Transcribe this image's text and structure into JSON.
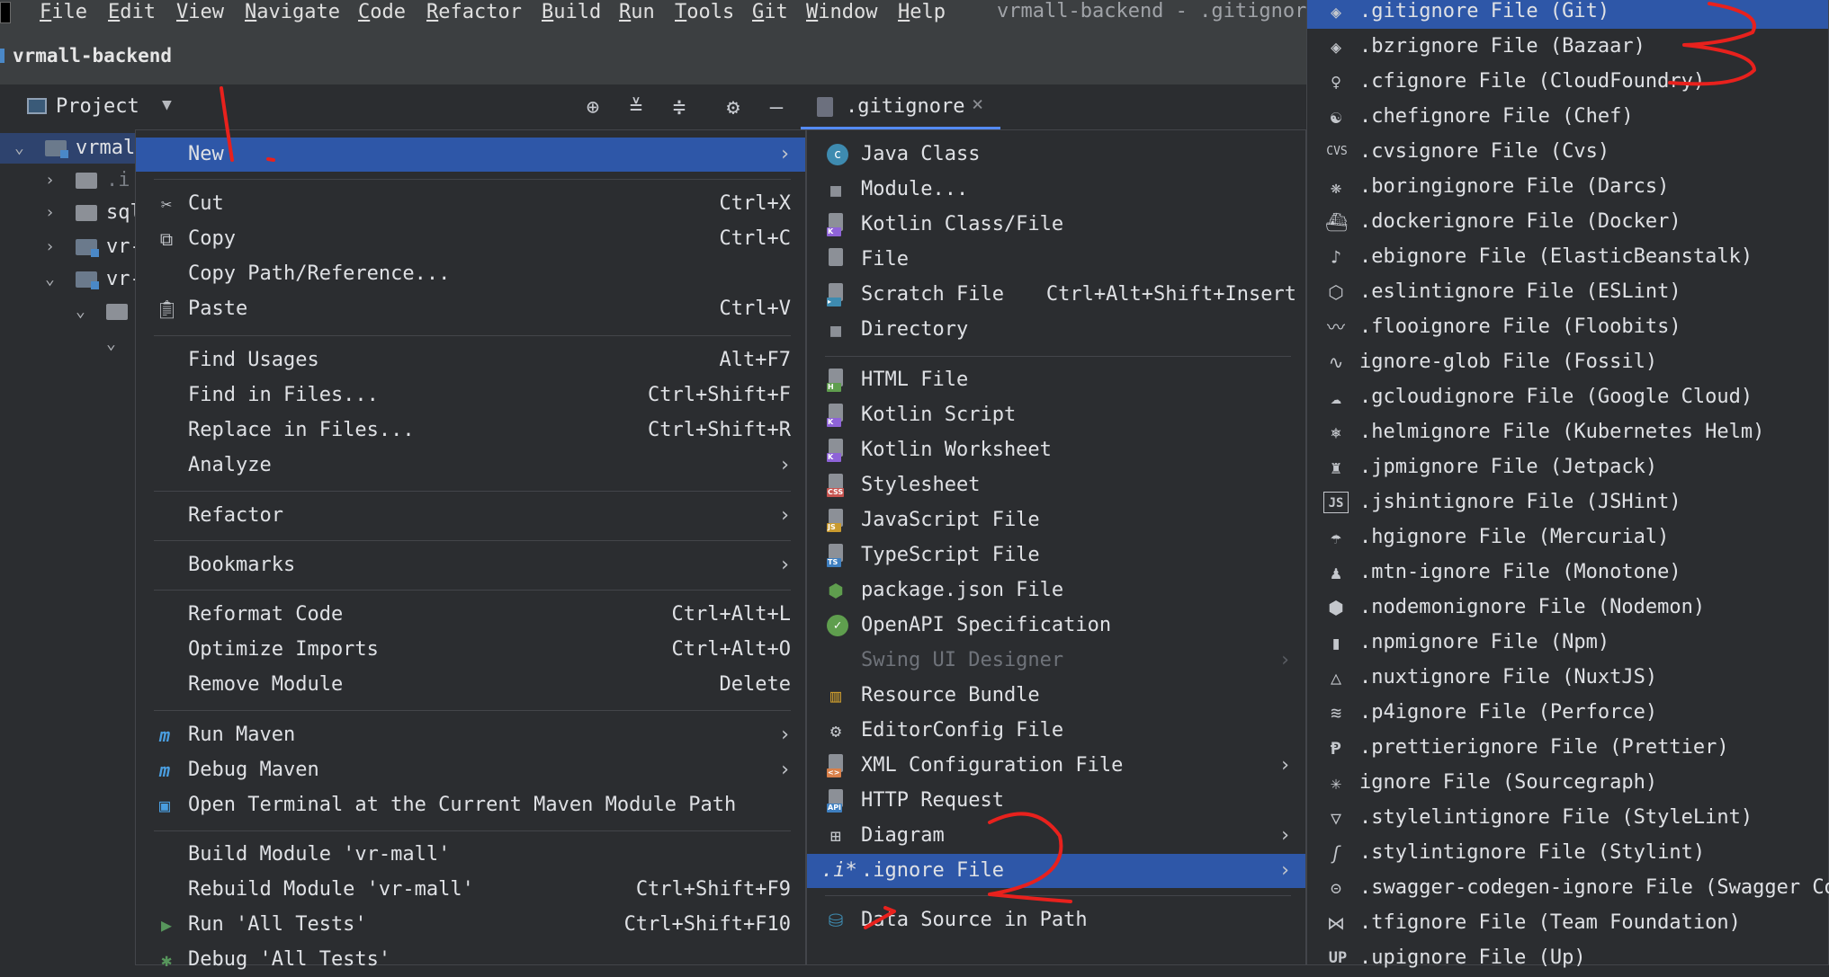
{
  "menubar": {
    "items": [
      "File",
      "Edit",
      "View",
      "Navigate",
      "Code",
      "Refactor",
      "Build",
      "Run",
      "Tools",
      "Git",
      "Window",
      "Help"
    ],
    "window_title": "vrmall-backend - .gitignore"
  },
  "project": {
    "name": "vrmall-backend"
  },
  "toolwindow": {
    "view_label": "Project"
  },
  "editor_tab": {
    "label": ".gitignore"
  },
  "tree": {
    "rows": [
      {
        "label": "vrmal"
      },
      {
        "label": ".i"
      },
      {
        "label": "sql"
      },
      {
        "label": "vr-"
      },
      {
        "label": "vr-"
      }
    ]
  },
  "context_menu": {
    "new": "New",
    "cut": {
      "label": "Cut",
      "shortcut": "Ctrl+X"
    },
    "copy": {
      "label": "Copy",
      "shortcut": "Ctrl+C"
    },
    "copy_path": "Copy Path/Reference...",
    "paste": {
      "label": "Paste",
      "shortcut": "Ctrl+V"
    },
    "find_usages": {
      "label": "Find Usages",
      "shortcut": "Alt+F7"
    },
    "find_in_files": {
      "label": "Find in Files...",
      "shortcut": "Ctrl+Shift+F"
    },
    "replace_in_files": {
      "label": "Replace in Files...",
      "shortcut": "Ctrl+Shift+R"
    },
    "analyze": "Analyze",
    "refactor": "Refactor",
    "bookmarks": "Bookmarks",
    "reformat": {
      "label": "Reformat Code",
      "shortcut": "Ctrl+Alt+L"
    },
    "optimize": {
      "label": "Optimize Imports",
      "shortcut": "Ctrl+Alt+O"
    },
    "remove_module": {
      "label": "Remove Module",
      "shortcut": "Delete"
    },
    "run_maven": "Run Maven",
    "debug_maven": "Debug Maven",
    "open_terminal": "Open Terminal at the Current Maven Module Path",
    "build_module": "Build Module 'vr-mall'",
    "rebuild_module": {
      "label": "Rebuild Module 'vr-mall'",
      "shortcut": "Ctrl+Shift+F9"
    },
    "run_tests": {
      "label": "Run 'All Tests'",
      "shortcut": "Ctrl+Shift+F10"
    },
    "debug_tests": "Debug 'All Tests'"
  },
  "new_submenu": {
    "java_class": "Java Class",
    "module": "Module...",
    "kotlin_class": "Kotlin Class/File",
    "file": "File",
    "scratch": {
      "label": "Scratch File",
      "shortcut": "Ctrl+Alt+Shift+Insert"
    },
    "directory": "Directory",
    "html": "HTML File",
    "kotlin_script": "Kotlin Script",
    "kotlin_worksheet": "Kotlin Worksheet",
    "stylesheet": "Stylesheet",
    "javascript": "JavaScript File",
    "typescript": "TypeScript File",
    "package_json": "package.json File",
    "openapi": "OpenAPI Specification",
    "swing": "Swing UI Designer",
    "resource_bundle": "Resource Bundle",
    "editorconfig": "EditorConfig File",
    "xml_config": "XML Configuration File",
    "http_request": "HTTP Request",
    "diagram": "Diagram",
    "ignore_file": ".ignore File",
    "ignore_icon_text": ".i*",
    "data_source": "Data Source in Path"
  },
  "ignore_submenu": {
    "items": [
      ".gitignore File (Git)",
      ".bzrignore File (Bazaar)",
      ".cfignore File (CloudFoundry)",
      ".chefignore File (Chef)",
      ".cvsignore File (Cvs)",
      ".boringignore File (Darcs)",
      ".dockerignore File (Docker)",
      ".ebignore File (ElasticBeanstalk)",
      ".eslintignore File (ESLint)",
      ".flooignore File (Floobits)",
      "ignore-glob File (Fossil)",
      ".gcloudignore File (Google Cloud)",
      ".helmignore File (Kubernetes Helm)",
      ".jpmignore File (Jetpack)",
      ".jshintignore File (JSHint)",
      ".hgignore File (Mercurial)",
      ".mtn-ignore File (Monotone)",
      ".nodemonignore File (Nodemon)",
      ".npmignore File (Npm)",
      ".nuxtignore File (NuxtJS)",
      ".p4ignore File (Perforce)",
      ".prettierignore File (Prettier)",
      "ignore File (Sourcegraph)",
      ".stylelintignore File (StyleLint)",
      ".stylintignore File (Stylint)",
      ".swagger-codegen-ignore File (Swagger Codegen)",
      ".tfignore File (Team Foundation)",
      ".upignore File (Up)"
    ],
    "icon_text": {
      "cvs": "CVS",
      "js": "JS",
      "up": "UP"
    }
  },
  "colors": {
    "highlight": "#2e57a8",
    "background": "#2b2d30",
    "annotation": "#e8211d"
  }
}
